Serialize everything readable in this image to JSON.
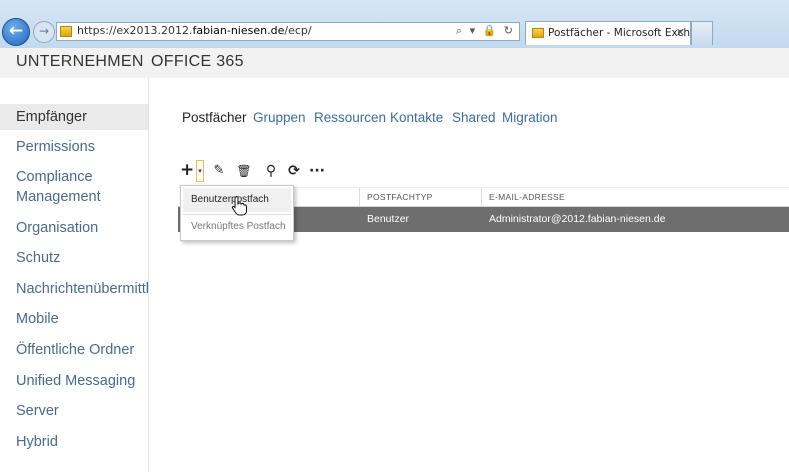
{
  "browser": {
    "url_prefix": "https://ex2013.2012.",
    "url_domain": "fabian-niesen.de",
    "url_suffix": "/ecp/",
    "tab_title": "Postfächer - Microsoft Exch...",
    "back_glyph": "←",
    "forward_glyph": "→",
    "tab_close_glyph": "✕",
    "address_icons": "⌕ ▾ 🔒 ↻"
  },
  "header": {
    "items": [
      "UNTERNEHMEN",
      "OFFICE 365"
    ]
  },
  "sidebar": {
    "items": [
      {
        "label": "Empfänger",
        "active": true
      },
      {
        "label": "Permissions"
      },
      {
        "label": "Compliance"
      },
      {
        "label": "Management"
      },
      {
        "label": "Organisation"
      },
      {
        "label": "Schutz"
      },
      {
        "label": "Nachrichtenübermittlung"
      },
      {
        "label": "Mobile"
      },
      {
        "label": "Öffentliche Ordner"
      },
      {
        "label": "Unified Messaging"
      },
      {
        "label": "Server"
      },
      {
        "label": "Hybrid"
      }
    ]
  },
  "tabs": [
    {
      "label": "Postfächer",
      "active": true
    },
    {
      "label": "Gruppen"
    },
    {
      "label": "Ressourcen"
    },
    {
      "label": "Kontakte"
    },
    {
      "label": "Shared"
    },
    {
      "label": "Migration"
    }
  ],
  "toolbar": {
    "add_glyph": "+",
    "add_dropdown_glyph": "▾",
    "edit_glyph": "✎",
    "delete_glyph": "🗑",
    "search_glyph": "⚲",
    "refresh_glyph": "⟳",
    "more_glyph": "···"
  },
  "table": {
    "columns": [
      "POSTFACHTYP",
      "E-MAIL-ADRESSE"
    ],
    "rows": [
      {
        "type": "Benutzer",
        "email": "Administrator@2012.fabian-niesen.de"
      }
    ]
  },
  "menu": {
    "items": [
      "Benutzerpostfach",
      "Verknüpftes Postfach"
    ]
  },
  "colors": {
    "selected_row": "#6e6e6e",
    "link": "#3b6e9a",
    "sidebar_text": "#4a6a8a"
  }
}
